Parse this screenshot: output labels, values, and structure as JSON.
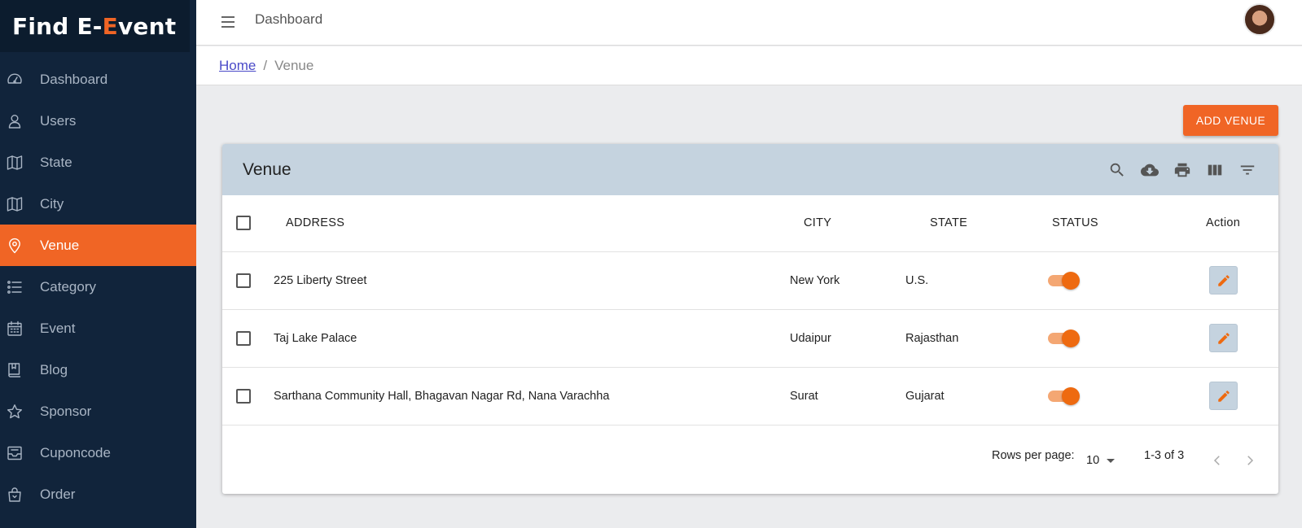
{
  "brand": {
    "part1": "Find E-",
    "accent": "E",
    "part2": "vent",
    "accent_color": "#f06525"
  },
  "sidebar": {
    "items": [
      {
        "label": "Dashboard",
        "icon": "gauge-icon"
      },
      {
        "label": "Users",
        "icon": "user-icon"
      },
      {
        "label": "State",
        "icon": "map-icon"
      },
      {
        "label": "City",
        "icon": "map-icon"
      },
      {
        "label": "Venue",
        "icon": "location-pin-icon",
        "active": true
      },
      {
        "label": "Category",
        "icon": "list-icon"
      },
      {
        "label": "Event",
        "icon": "calendar-icon"
      },
      {
        "label": "Blog",
        "icon": "book-icon"
      },
      {
        "label": "Sponsor",
        "icon": "star-icon"
      },
      {
        "label": "Cuponcode",
        "icon": "inbox-icon"
      },
      {
        "label": "Order",
        "icon": "shopping-bag-icon"
      }
    ]
  },
  "topbar": {
    "title": "Dashboard"
  },
  "breadcrumb": {
    "home": "Home",
    "separator": "/",
    "current": "Venue"
  },
  "actions": {
    "add_label": "ADD VENUE"
  },
  "table": {
    "title": "Venue",
    "tools": [
      "search-icon",
      "download-icon",
      "print-icon",
      "view-columns-icon",
      "filter-icon"
    ],
    "columns": {
      "address": "ADDRESS",
      "city": "CITY",
      "state": "STATE",
      "status": "STATUS",
      "action": "Action"
    },
    "rows": [
      {
        "address": "225 Liberty Street",
        "city": "New York",
        "state": "U.S.",
        "status": true
      },
      {
        "address": "Taj Lake Palace",
        "city": "Udaipur",
        "state": "Rajasthan",
        "status": true
      },
      {
        "address": "Sarthana Community Hall, Bhagavan Nagar Rd, Nana Varachha",
        "city": "Surat",
        "state": "Gujarat",
        "status": true
      }
    ],
    "footer": {
      "rows_per_page_label": "Rows per page:",
      "rows_per_page_value": "10",
      "range": "1-3 of 3"
    }
  },
  "colors": {
    "sidebar_bg": "#11243b",
    "accent": "#f06525",
    "card_header": "#c5d3df"
  }
}
